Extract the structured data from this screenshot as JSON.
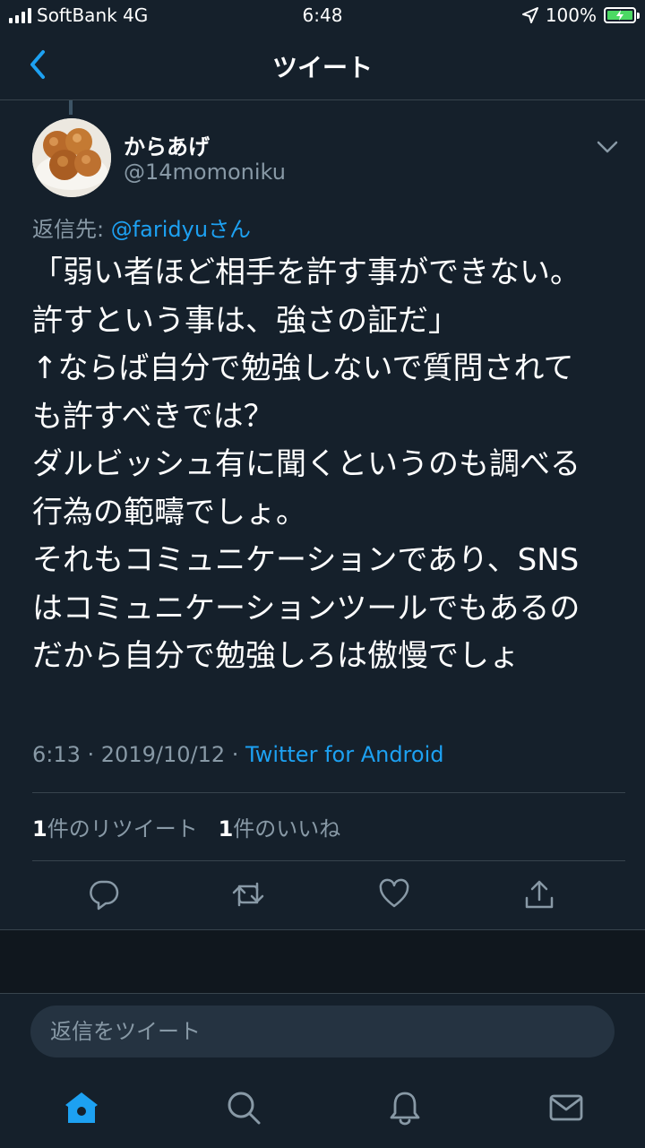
{
  "status_bar": {
    "carrier": "SoftBank 4G",
    "time": "6:48",
    "battery": "100%"
  },
  "nav": {
    "title": "ツイート"
  },
  "tweet": {
    "display_name": "からあげ",
    "handle": "@14momoniku",
    "reply_prefix": "返信先: ",
    "reply_mention": "@faridyu",
    "reply_suffix": "さん",
    "text": "「弱い者ほど相手を許す事ができない。\n許すという事は、強さの証だ」\n↑ならば自分で勉強しないで質問されて\nも許すべきでは？\nダルビッシュ有に聞くというのも調べる\n行為の範疇でしょ。\nそれもコミュニケーションであり、SNS\nはコミュニケーションツールでもあるの\nだから自分で勉強しろは傲慢でしょ",
    "time": "6:13 · 2019/10/12 · ",
    "source": "Twitter for Android",
    "retweet_count": "1",
    "retweet_label": "件のリツイート",
    "like_count": "1",
    "like_label": "件のいいね"
  },
  "reply_box": {
    "placeholder": "返信をツイート"
  },
  "icons": {
    "back": "chevron-left-icon",
    "caret": "chevron-down-icon",
    "reply": "reply-icon",
    "retweet": "retweet-icon",
    "like": "heart-icon",
    "share": "share-icon",
    "home": "home-icon",
    "search": "search-icon",
    "notifications": "bell-icon",
    "messages": "mail-icon"
  },
  "colors": {
    "background": "#15202b",
    "accent": "#1da1f2",
    "secondary_text": "#8899a6",
    "divider": "#38444d"
  }
}
